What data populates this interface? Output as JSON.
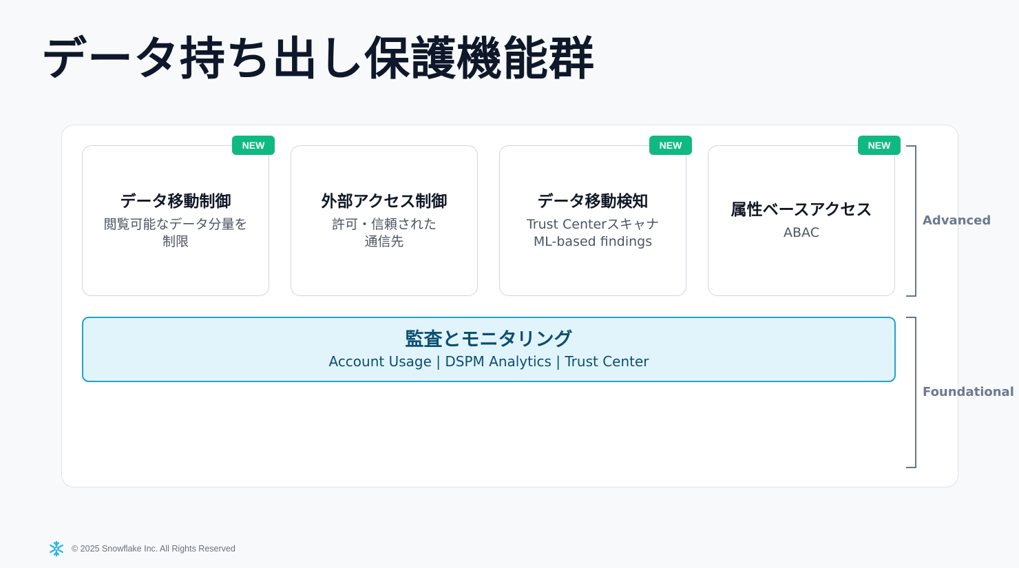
{
  "title": "データ持ち出し保護機能群",
  "advanced_cards": [
    {
      "badge": "NEW",
      "title": "データ移動制御",
      "sub": [
        "閲覧可能なデータ分量を",
        "制限"
      ]
    },
    {
      "badge": "",
      "title": "外部アクセス制御",
      "sub": [
        "許可・信頼された",
        "通信先"
      ]
    },
    {
      "badge": "NEW",
      "title": "データ移動検知",
      "sub": [
        "Trust Centerスキャナ",
        "ML-based findings"
      ]
    },
    {
      "badge": "NEW",
      "title": "属性ベースアクセス",
      "sub": [
        "ABAC"
      ]
    }
  ],
  "foundational": {
    "title": "監査とモニタリング",
    "sub": "Account Usage | DSPM Analytics | Trust Center"
  },
  "tiers": {
    "advanced": "Advanced",
    "foundational": "Foundational"
  },
  "footer": {
    "logo_icon": "snowflake-icon",
    "copyright": "© 2025 Snowflake Inc. All Rights Reserved"
  },
  "colors": {
    "badge": "#10b981",
    "foundation_bg": "#e2f4fb",
    "foundation_border": "#1aa3d0",
    "logo": "#29b5e8"
  }
}
